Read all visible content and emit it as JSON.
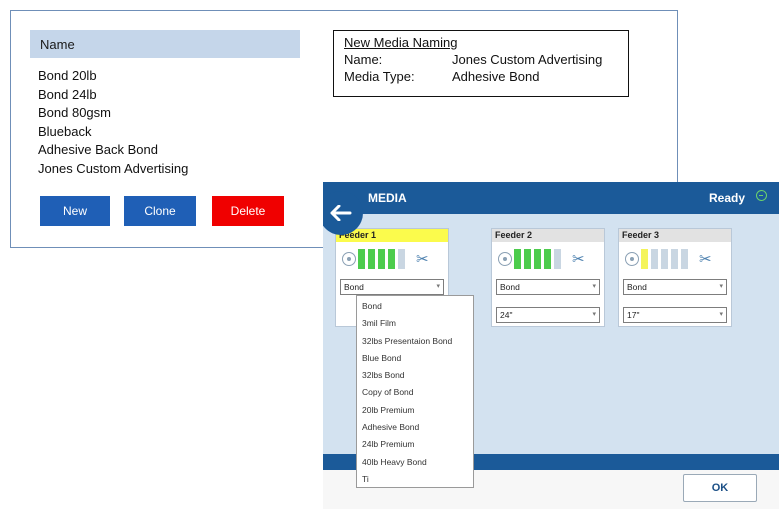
{
  "media_list": {
    "header": "Name",
    "items": [
      "Bond 20lb",
      "Bond 24lb",
      "Bond 80gsm",
      "Blueback",
      "Adhesive Back Bond",
      "Jones Custom Advertising"
    ],
    "buttons": {
      "new": "New",
      "clone": "Clone",
      "delete": "Delete"
    }
  },
  "naming": {
    "title": "New Media Naming",
    "name_label": "Name:",
    "name_value": "Jones Custom Advertising",
    "type_label": "Media Type:",
    "type_value": "Adhesive Bond"
  },
  "media_window": {
    "title": "MEDIA",
    "status": "Ready",
    "ok_label": "OK",
    "feeders": [
      {
        "title": "Feeder 1",
        "media": "Bond",
        "size": "",
        "active": true
      },
      {
        "title": "Feeder 2",
        "media": "Bond",
        "size": "24\"",
        "active": false
      },
      {
        "title": "Feeder 3",
        "media": "Bond",
        "size": "17\"",
        "active": false
      }
    ],
    "dropdown_options": [
      "Bond",
      "3mil Film",
      "32lbs Presentaion Bond",
      "Blue Bond",
      "32lbs Bond",
      "Copy of Bond",
      "20lb Premium",
      "Adhesive Bond",
      "24lb Premium",
      "40lb Heavy Bond",
      "Ti"
    ]
  },
  "colors": {
    "header_blue": "#1b5a99",
    "primary_button": "#1f5fb6",
    "delete_button": "#f00000",
    "active_feeder": "#fbfb4c",
    "ink_green": "#4ccc4c",
    "ink_yellow": "#f4f45a"
  }
}
